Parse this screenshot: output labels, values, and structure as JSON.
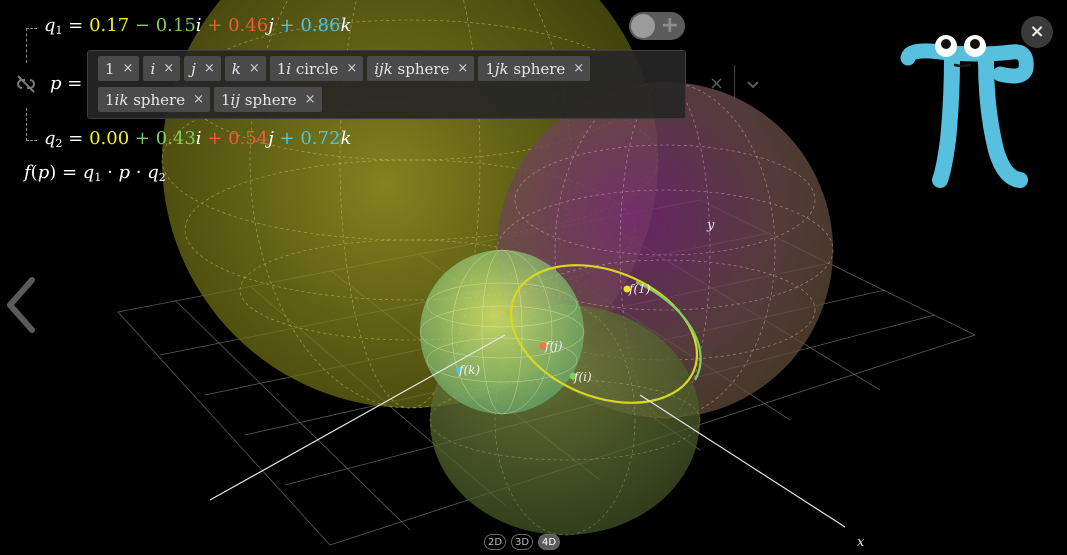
{
  "equations": {
    "q1": {
      "name": "q",
      "sub": "1",
      "real": "0.17",
      "op_i": "−",
      "i_coef": "0.15",
      "op_j": "+",
      "j_coef": "0.46",
      "op_k": "+",
      "k_coef": "0.86"
    },
    "q2": {
      "name": "q",
      "sub": "2",
      "real": "0.00",
      "op_i": "+",
      "i_coef": "0.43",
      "op_j": "+",
      "j_coef": "0.54",
      "op_k": "+",
      "k_coef": "0.72"
    },
    "p_symbol": "p",
    "function": {
      "f": "f",
      "p": "p",
      "q": "q",
      "sub1": "1",
      "sub2": "2"
    }
  },
  "inputs": {
    "chips_row1": [
      {
        "plain": "1",
        "ital": "",
        "suffix": ""
      },
      {
        "plain": "",
        "ital": "i",
        "suffix": ""
      },
      {
        "plain": "",
        "ital": "j",
        "suffix": ""
      },
      {
        "plain": "",
        "ital": "k",
        "suffix": ""
      },
      {
        "plain": "1",
        "ital": "i",
        "suffix": " circle"
      },
      {
        "plain": "",
        "ital": "ijk",
        "suffix": " sphere"
      },
      {
        "plain": "1",
        "ital": "jk",
        "suffix": " sphere"
      }
    ],
    "chips_row2": [
      {
        "plain": "1",
        "ital": "ik",
        "suffix": " sphere"
      },
      {
        "plain": "1",
        "ital": "ij",
        "suffix": " sphere"
      }
    ],
    "remove_glyph": "×",
    "clear_all_glyph": "×"
  },
  "toggle": {
    "plus": "+"
  },
  "close": {
    "glyph": "×"
  },
  "dimension_buttons": [
    "2D",
    "3D",
    "4D"
  ],
  "active_dimension": "4D",
  "axes": {
    "x": "x",
    "y": "y"
  },
  "points": {
    "f1": {
      "label": "f(1)",
      "color": "#f4e21a"
    },
    "fj": {
      "label": "f(j)",
      "color": "#f07838"
    },
    "fi": {
      "label": "f(i)",
      "color": "#7fcf5e"
    },
    "fk": {
      "label": "f(k)",
      "color": "#4cc4e6"
    }
  },
  "colors": {
    "yellow": "#f4f119",
    "green": "#7fcf5e",
    "red": "#f05a3c",
    "blue": "#4cc4e6",
    "big_sphere": "#8a8a1c",
    "magenta_sphere": "#7a3a6a",
    "pi_logo": "#58c0df"
  },
  "icons": [
    "link-icon",
    "back-arrow-icon",
    "close-icon",
    "chevron-down-icon",
    "pi-logo"
  ]
}
